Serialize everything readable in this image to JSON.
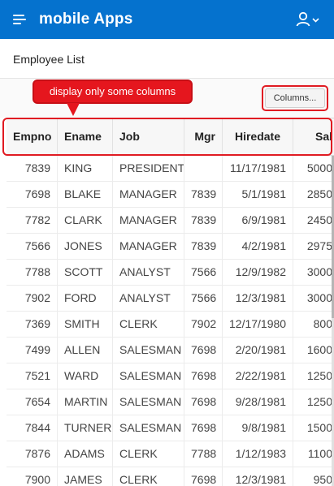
{
  "app": {
    "title": "mobile Apps"
  },
  "region": {
    "title": "Employee List"
  },
  "callout": {
    "text": "display only some columns"
  },
  "toolbar": {
    "columns_label": "Columns..."
  },
  "grid": {
    "columns": [
      "Empno",
      "Ename",
      "Job",
      "Mgr",
      "Hiredate",
      "Sal"
    ],
    "rows": [
      [
        "7839",
        "KING",
        "PRESIDENT",
        "",
        "11/17/1981",
        "5000"
      ],
      [
        "7698",
        "BLAKE",
        "MANAGER",
        "7839",
        "5/1/1981",
        "2850"
      ],
      [
        "7782",
        "CLARK",
        "MANAGER",
        "7839",
        "6/9/1981",
        "2450"
      ],
      [
        "7566",
        "JONES",
        "MANAGER",
        "7839",
        "4/2/1981",
        "2975"
      ],
      [
        "7788",
        "SCOTT",
        "ANALYST",
        "7566",
        "12/9/1982",
        "3000"
      ],
      [
        "7902",
        "FORD",
        "ANALYST",
        "7566",
        "12/3/1981",
        "3000"
      ],
      [
        "7369",
        "SMITH",
        "CLERK",
        "7902",
        "12/17/1980",
        "800"
      ],
      [
        "7499",
        "ALLEN",
        "SALESMAN",
        "7698",
        "2/20/1981",
        "1600"
      ],
      [
        "7521",
        "WARD",
        "SALESMAN",
        "7698",
        "2/22/1981",
        "1250"
      ],
      [
        "7654",
        "MARTIN",
        "SALESMAN",
        "7698",
        "9/28/1981",
        "1250"
      ],
      [
        "7844",
        "TURNER",
        "SALESMAN",
        "7698",
        "9/8/1981",
        "1500"
      ],
      [
        "7876",
        "ADAMS",
        "CLERK",
        "7788",
        "1/12/1983",
        "1100"
      ],
      [
        "7900",
        "JAMES",
        "CLERK",
        "7698",
        "12/3/1981",
        "950"
      ]
    ]
  },
  "colors": {
    "header_bg": "#0572ce",
    "highlight": "#e01b22",
    "callout_bg": "#e5161e"
  },
  "icons": {
    "menu": "hamburger-menu-icon",
    "user": "user-icon",
    "user_caret": "chevron-down-icon"
  }
}
